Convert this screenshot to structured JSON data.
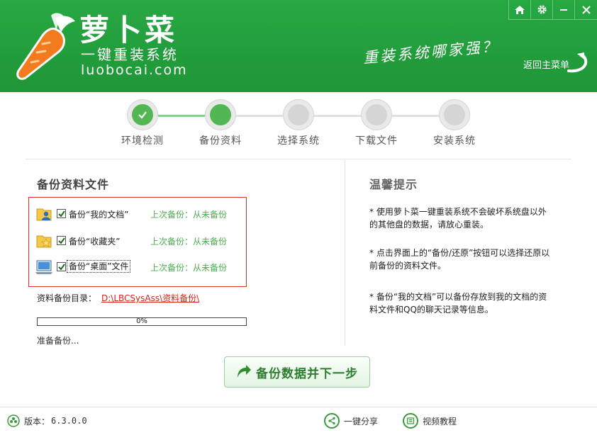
{
  "colors": {
    "brand_green": "#22a13c",
    "accent_green": "#52b652",
    "warn_red": "#d9342b"
  },
  "header": {
    "brand_name": "萝卜菜",
    "brand_sub": "一键重装系统",
    "brand_url": "luobocai.com",
    "slogan": "重装系统哪家强？",
    "back_main": "返回主菜单",
    "controls": [
      "home-icon",
      "gear-icon",
      "minimize-icon",
      "close-icon"
    ]
  },
  "steps": [
    {
      "label": "环境检测",
      "state": "done"
    },
    {
      "label": "备份资料",
      "state": "active"
    },
    {
      "label": "选择系统",
      "state": "pending"
    },
    {
      "label": "下载文件",
      "state": "pending"
    },
    {
      "label": "安装系统",
      "state": "pending"
    }
  ],
  "backup": {
    "title": "备份资料文件",
    "items": [
      {
        "label": "备份“我的文档”",
        "status": "上次备份：从未备份",
        "checked": true,
        "icon": "user-folder-icon"
      },
      {
        "label": "备份“收藏夹”",
        "status": "上次备份：从未备份",
        "checked": true,
        "icon": "favorites-folder-icon"
      },
      {
        "label": "备份“桌面”文件",
        "status": "上次备份：从未备份",
        "checked": true,
        "icon": "desktop-icon"
      }
    ],
    "dir_label": "资料备份目录：",
    "dir_path": "D:\\LBCSysAss\\资料备份\\",
    "progress_text": "0%",
    "progress_value": 0,
    "status": "准备备份..."
  },
  "tips": {
    "title": "温馨提示",
    "items": [
      "* 使用萝卜菜一键重装系统不会破坏系统盘以外的其他盘的数据，请放心重装。",
      "* 点击界面上的“备份/还原”按钮可以选择还原以前备份的资料文件。",
      "* 备份“我的文档”可以备份存放到我的文档的资料文件和QQ的聊天记录等信息。"
    ]
  },
  "main_button": "备份数据并下一步",
  "footer": {
    "version_label": "版本：",
    "version": "6.3.0.0",
    "share": "一键分享",
    "video": "视频教程"
  }
}
